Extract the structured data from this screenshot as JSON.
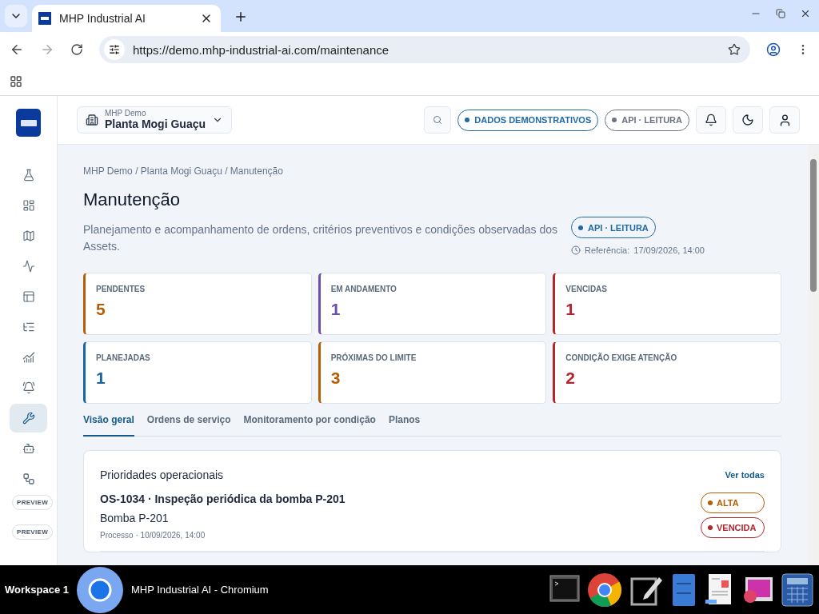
{
  "browser": {
    "tab_title": "MHP Industrial AI",
    "url": "https://demo.mhp-industrial-ai.com/maintenance"
  },
  "header": {
    "org": "MHP Demo",
    "plant": "Planta Mogi Guaçu",
    "badges": [
      {
        "label": "DADOS DEMONSTRATIVOS",
        "color": "#1f6aa5"
      },
      {
        "label": "API · LEITURA",
        "color": "#6b7280"
      }
    ]
  },
  "sidebar": {
    "items": [
      {
        "selected": false
      },
      {
        "selected": false
      },
      {
        "selected": false
      },
      {
        "selected": false
      },
      {
        "selected": false
      },
      {
        "selected": false
      },
      {
        "selected": false
      },
      {
        "selected": false
      },
      {
        "selected": true
      },
      {
        "selected": false
      }
    ],
    "previews": [
      "PREVIEW",
      "PREVIEW"
    ]
  },
  "page": {
    "breadcrumb": "MHP Demo / Planta Mogi Guaçu / Manutenção",
    "title": "Manutenção",
    "description": "Planejamento e acompanhamento de ordens, critérios preventivos e condições observadas dos Assets.",
    "api_badge": "API · LEITURA",
    "reference_label": "Referência:",
    "reference_value": "17/09/2026, 14:00"
  },
  "cards": [
    {
      "label": "PENDENTES",
      "value": "5",
      "color": "#b45f06"
    },
    {
      "label": "EM ANDAMENTO",
      "value": "1",
      "color": "#6b4fae"
    },
    {
      "label": "VENCIDAS",
      "value": "1",
      "color": "#b3262e"
    },
    {
      "label": "PLANEJADAS",
      "value": "1",
      "color": "#1a659e"
    },
    {
      "label": "PRÓXIMAS DO LIMITE",
      "value": "3",
      "color": "#b45f06"
    },
    {
      "label": "CONDIÇÃO EXIGE ATENÇÃO",
      "value": "2",
      "color": "#b3262e"
    }
  ],
  "tabs": [
    {
      "label": "Visão geral",
      "selected": true
    },
    {
      "label": "Ordens de serviço",
      "selected": false
    },
    {
      "label": "Monitoramento por condição",
      "selected": false
    },
    {
      "label": "Planos",
      "selected": false
    }
  ],
  "priorities": {
    "title": "Prioridades operacionais",
    "link": "Ver todas",
    "orders": [
      {
        "title": "OS-1034 · Inspeção periódica da bomba P-201",
        "asset": "Bomba P-201",
        "meta": "Processo · 10/09/2026, 14:00",
        "badges": [
          {
            "label": "ALTA",
            "color": "#b45f06"
          },
          {
            "label": "VENCIDA",
            "color": "#b3262e"
          }
        ]
      }
    ]
  },
  "taskbar": {
    "workspace": "Workspace 1",
    "window_title": "MHP Industrial AI - Chromium"
  }
}
